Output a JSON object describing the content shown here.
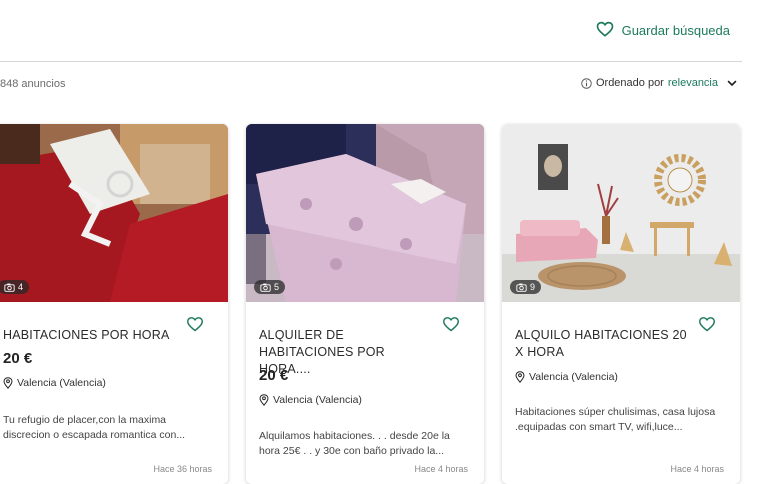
{
  "header": {
    "save_search_label": "Guardar búsqueda"
  },
  "results": {
    "count_text": "848 anuncios",
    "sort_prefix": "Ordenado por",
    "sort_value": "relevancia"
  },
  "colors": {
    "accent": "#1c7a5e"
  },
  "listings": [
    {
      "photo_count": "4",
      "title": "HABITACIONES POR HORA",
      "price": "20 €",
      "location": "Valencia (Valencia)",
      "description": "Tu refugio de placer,con la maxima discrecion o escapada romantica con...",
      "time": "Hace 36 horas"
    },
    {
      "photo_count": "5",
      "title": "ALQUILER DE HABITACIONES POR HORA....",
      "price": "20 €",
      "location": "Valencia (Valencia)",
      "description": "Alquilamos habitaciones. . . desde 20e la hora 25€ . . y 30e con baño privado la...",
      "time": "Hace 4 horas"
    },
    {
      "photo_count": "9",
      "title": "ALQUILO HABITACIONES 20 X HORA",
      "price": "",
      "location": "Valencia (Valencia)",
      "description": "Habitaciones súper chulisimas, casa lujosa .equipadas con smart TV, wifi,luce...",
      "time": "Hace 4 horas"
    }
  ]
}
